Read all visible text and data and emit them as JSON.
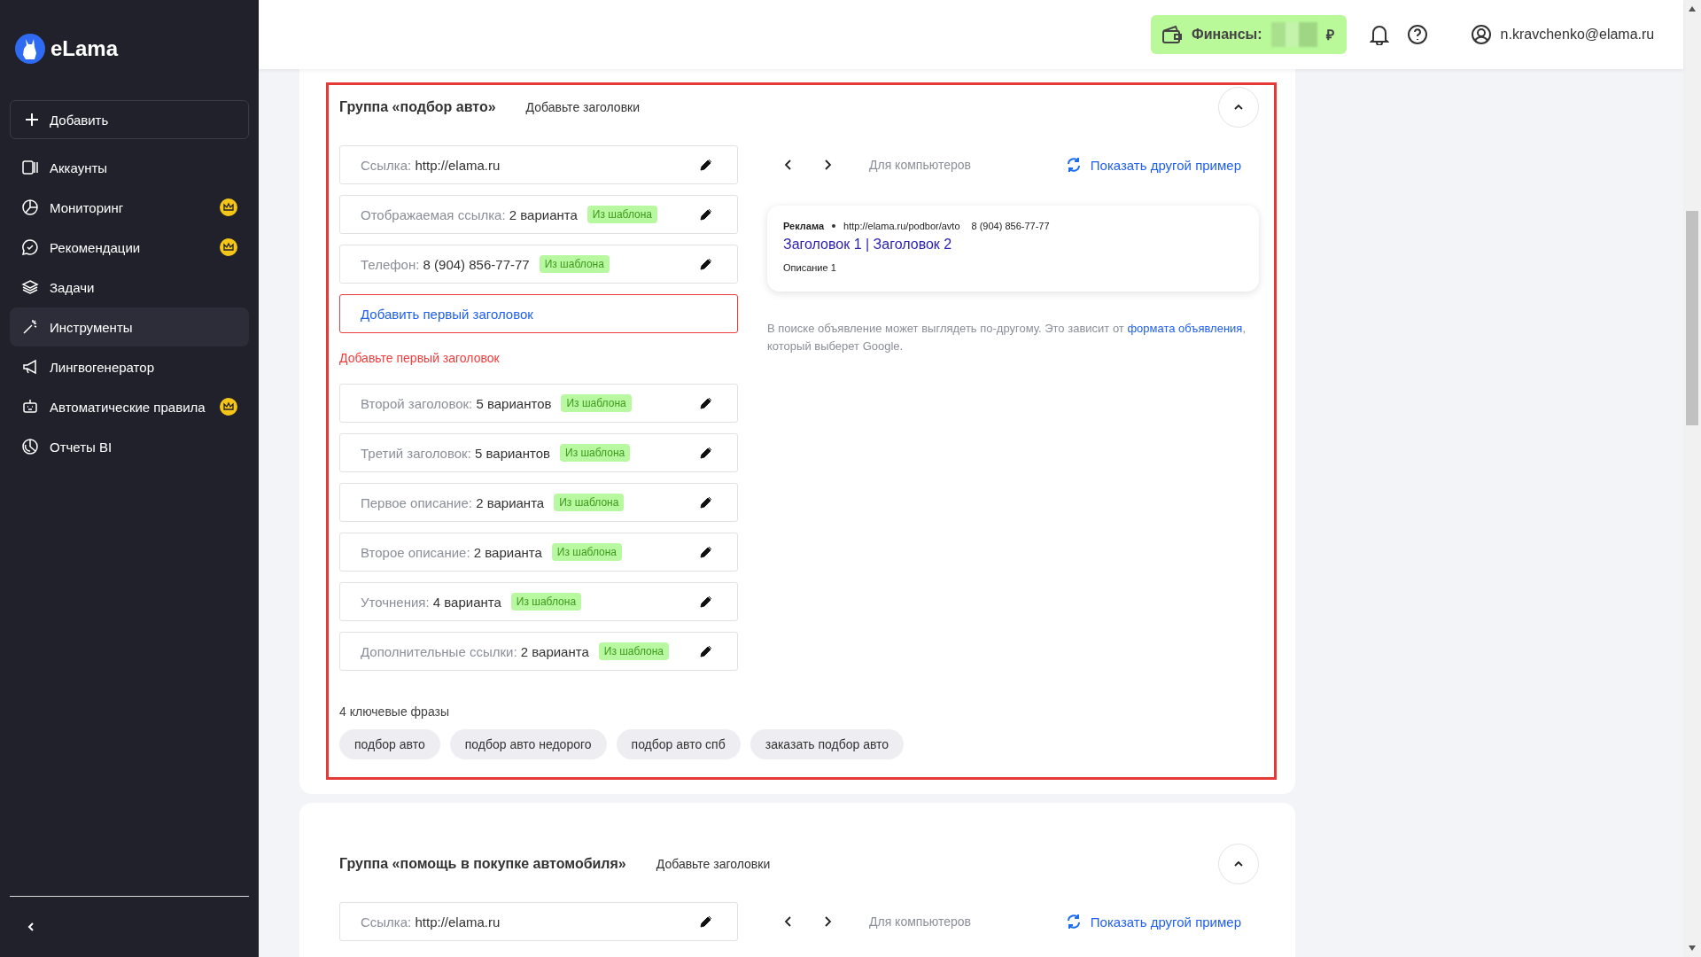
{
  "sidebar": {
    "logo": "eLama",
    "add_button": "Добавить",
    "items": [
      {
        "label": "Аккаунты",
        "kind": "accounts",
        "premium": false,
        "selected": false
      },
      {
        "label": "Мониторинг",
        "kind": "monitoring",
        "premium": true,
        "selected": false
      },
      {
        "label": "Рекомендации",
        "kind": "chat",
        "premium": true,
        "selected": false
      },
      {
        "label": "Задачи",
        "kind": "layers",
        "premium": false,
        "selected": false
      },
      {
        "label": "Инструменты",
        "kind": "wand",
        "premium": false,
        "selected": true
      },
      {
        "label": "Лингвогенератор",
        "kind": "megaphone",
        "premium": false,
        "selected": false
      },
      {
        "label": "Автоматические правила",
        "kind": "robot",
        "premium": true,
        "selected": false
      },
      {
        "label": "Отчеты BI",
        "kind": "report",
        "premium": false,
        "selected": false
      }
    ]
  },
  "header": {
    "finance_label": "Финансы:",
    "currency": "₽",
    "user": "n.kravchenko@elama.ru"
  },
  "groups": [
    {
      "title": "Группа «подбор авто»",
      "hint": "Добавьте заголовки",
      "highlighted": true,
      "expanded": true,
      "fields": [
        {
          "kind": "field",
          "label": "Ссылка:",
          "value": "http://elama.ru"
        },
        {
          "kind": "field",
          "label": "Отображаемая ссылка:",
          "value": "2 варианта",
          "badge": "Из шаблона"
        },
        {
          "kind": "field",
          "label": "Телефон:",
          "value": "8 (904) 856-77-77",
          "badge": "Из шаблона"
        },
        {
          "kind": "missing",
          "action": "Добавить первый заголовок",
          "error": "Добавьте первый заголовок"
        },
        {
          "kind": "field",
          "label": "Второй заголовок:",
          "value": "5 вариантов",
          "badge": "Из шаблона"
        },
        {
          "kind": "field",
          "label": "Третий заголовок:",
          "value": "5 вариантов",
          "badge": "Из шаблона"
        },
        {
          "kind": "field",
          "label": "Первое описание:",
          "value": "2 варианта",
          "badge": "Из шаблона"
        },
        {
          "kind": "field",
          "label": "Второе описание:",
          "value": "2 варианта",
          "badge": "Из шаблона"
        },
        {
          "kind": "field",
          "label": "Уточнения:",
          "value": "4 варианта",
          "badge": "Из шаблона"
        },
        {
          "kind": "field",
          "label": "Дополнительные ссылки:",
          "value": "2 варианта",
          "badge": "Из шаблона"
        }
      ],
      "preview": {
        "device": "Для компьютеров",
        "refresh": "Показать другой пример",
        "ad": {
          "label": "Реклама",
          "url": "http://elama.ru/podbor/avto",
          "phone": "8 (904) 856-77-77",
          "headline": "Заголовок 1 | Заголовок 2",
          "description": "Описание 1"
        },
        "note": {
          "before": "В поиске объявление может выглядеть по-другому. Это зависит от",
          "link": "формата объявления",
          "after": ", который выберет Google."
        }
      },
      "keywords": {
        "title": "4 ключевые фразы",
        "items": [
          "подбор авто",
          "подбор авто недорого",
          "подбор авто спб",
          "заказать подбор авто"
        ]
      }
    },
    {
      "title": "Группа «помощь в покупке автомобиля»",
      "hint": "Добавьте заголовки",
      "highlighted": false,
      "expanded": true,
      "fields": [
        {
          "kind": "field",
          "label": "Ссылка:",
          "value": "http://elama.ru"
        }
      ],
      "preview": {
        "device": "Для компьютеров",
        "refresh": "Показать другой пример"
      }
    }
  ]
}
